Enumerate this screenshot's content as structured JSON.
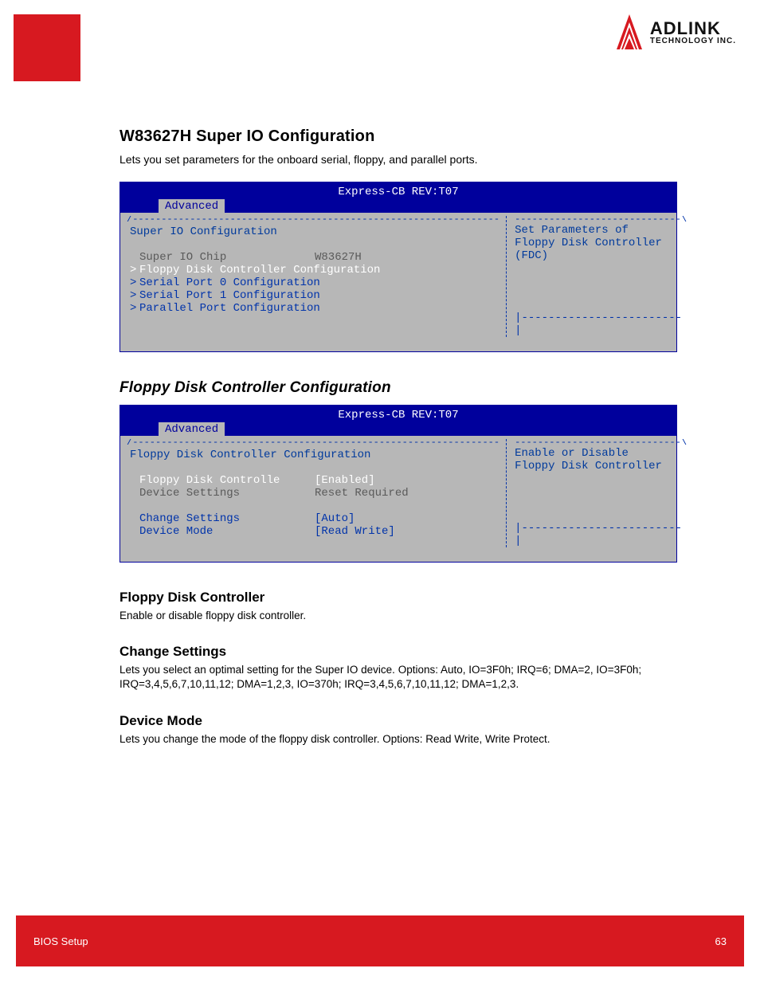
{
  "logo": {
    "line1": "ADLINK",
    "line2": "TECHNOLOGY INC."
  },
  "section": {
    "title": "W83627H Super IO Configuration",
    "body": "Lets you set parameters for the onboard serial, floppy, and parallel ports."
  },
  "bios1": {
    "title": "Express-CB REV:T07",
    "tab": "Advanced",
    "heading": "Super IO Configuration",
    "rows": [
      {
        "col1": "Super IO Chip",
        "col2": "W83627H",
        "style": "dim",
        "caret": ""
      },
      {
        "col1": "Floppy Disk Controller Configuration",
        "col2": "",
        "style": "sel",
        "caret": ">"
      },
      {
        "col1": "Serial Port 0 Configuration",
        "col2": "",
        "style": "link",
        "caret": ">"
      },
      {
        "col1": "Serial Port 1 Configuration",
        "col2": "",
        "style": "link",
        "caret": ">"
      },
      {
        "col1": "Parallel Port Configuration",
        "col2": "",
        "style": "link",
        "caret": ">"
      }
    ],
    "help": "Set Parameters of\nFloppy Disk Controller\n(FDC)"
  },
  "subsection_title": "Floppy Disk Controller Configuration",
  "bios2": {
    "title": "Express-CB REV:T07",
    "tab": "Advanced",
    "heading": "Floppy Disk Controller Configuration",
    "rows": [
      {
        "col1": "Floppy Disk Controlle",
        "col2": "[Enabled]",
        "style": "sel",
        "caret": ""
      },
      {
        "col1": "Device Settings",
        "col2": "Reset Required",
        "style": "dim",
        "caret": ""
      },
      {
        "col1": "",
        "col2": "",
        "style": "",
        "caret": ""
      },
      {
        "col1": "Change Settings",
        "col2": "[Auto]",
        "style": "link",
        "caret": ""
      },
      {
        "col1": "Device Mode",
        "col2": "[Read Write]",
        "style": "link",
        "caret": ""
      }
    ],
    "help": "Enable or Disable\nFloppy Disk Controller"
  },
  "subs": [
    {
      "h": "Floppy Disk Controller",
      "p": "Enable or disable floppy disk controller."
    },
    {
      "h": "Change Settings",
      "p": "Lets you select an optimal setting for the Super IO device. Options: Auto, IO=3F0h; IRQ=6; DMA=2, IO=3F0h; IRQ=3,4,5,6,7,10,11,12; DMA=1,2,3, IO=370h; IRQ=3,4,5,6,7,10,11,12; DMA=1,2,3."
    },
    {
      "h": "Device Mode",
      "p": "Lets you change the mode of the floppy disk controller. Options: Read Write, Write Protect."
    }
  ],
  "footer": {
    "left": "BIOS Setup",
    "right": "63"
  }
}
